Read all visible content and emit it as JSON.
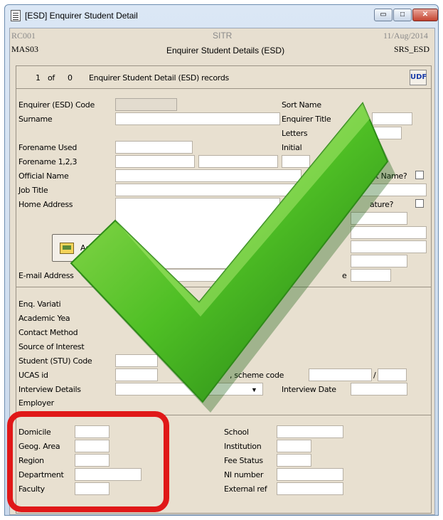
{
  "window": {
    "title": "[ESD] Enquirer Student Detail",
    "min_glyph": "▭",
    "max_glyph": "□",
    "close_glyph": "✕"
  },
  "header": {
    "left_top": "RC001",
    "center_top": "SITR",
    "right_top": "11/Aug/2014",
    "left_bottom": "MAS03",
    "center_bottom": "Enquirer Student Details (ESD)",
    "right_bottom": "SRS_ESD"
  },
  "records": {
    "current": "1",
    "of": "of",
    "total": "0",
    "label": "Enquirer Student Detail (ESD) records",
    "udf_label": "UDF"
  },
  "fields_left": {
    "code": "Enquirer (ESD) Code",
    "surname": "Surname",
    "forename_used": "Forename Used",
    "forename_123": "Forename 1,2,3",
    "official_name": "Official Name",
    "job_title": "Job Title",
    "home_address": "Home Address",
    "address_button": "Address",
    "email": "E-mail Address"
  },
  "fields_right": {
    "sort_name": "Sort Name",
    "enquirer_title": "Enquirer Title",
    "letters": "Letters",
    "initials": "Initial",
    "edit_name": "dit Name?",
    "nature": "ature?",
    "email_tail": "e"
  },
  "section2": {
    "variation": "Enq. Variati",
    "academic_year": "Academic Yea",
    "contact_method": "Contact Method",
    "source_of_interest": "Source of Interest",
    "student_code": "Student (STU) Code",
    "ucas_id": "UCAS id",
    "scheme_code": ", scheme code",
    "slash": "/",
    "interview_details": "Interview Details",
    "interview_date": "Interview Date",
    "employer_partial": "Employer"
  },
  "section3": {
    "domicile": "Domicile",
    "geog_area": "Geog. Area",
    "region": "Region",
    "department": "Department",
    "faculty": "Faculty",
    "school": "School",
    "institution": "Institution",
    "fee_status": "Fee Status",
    "ni_number": "NI number",
    "external_ref": "External ref"
  },
  "colors": {
    "panel_bg": "#e8e0d0",
    "checkmark_green": "#3faa1e",
    "highlight_red": "#e01818"
  },
  "icons": [
    "document-icon",
    "minimize-icon",
    "maximize-icon",
    "close-icon",
    "address-book-icon",
    "dropdown-arrow-icon",
    "checkmark-icon"
  ]
}
